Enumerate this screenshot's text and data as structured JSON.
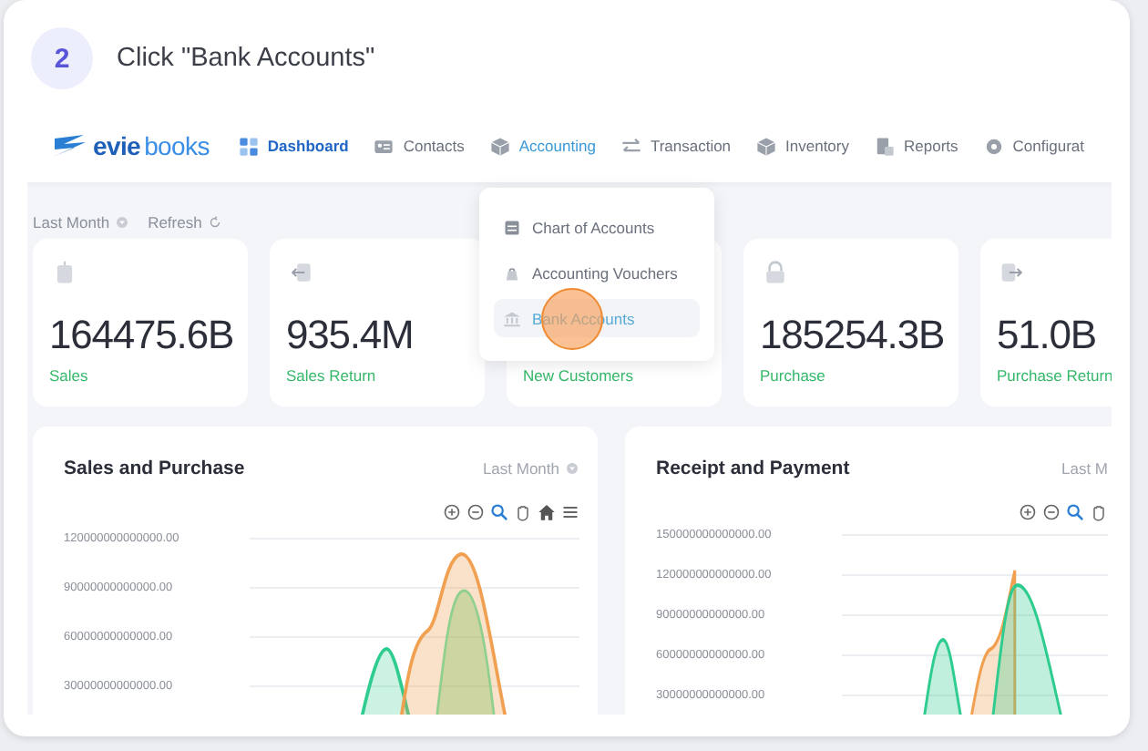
{
  "step": {
    "number": "2",
    "instruction": "Click \"Bank Accounts\""
  },
  "app": {
    "logo": {
      "part1": "evie",
      "part2": "books"
    },
    "nav": [
      {
        "label": "Dashboard",
        "selected": true
      },
      {
        "label": "Contacts",
        "selected": false
      },
      {
        "label": "Accounting",
        "selected": false,
        "open": true
      },
      {
        "label": "Transaction",
        "selected": false
      },
      {
        "label": "Inventory",
        "selected": false
      },
      {
        "label": "Reports",
        "selected": false
      },
      {
        "label": "Configurat",
        "selected": false
      }
    ],
    "filters": [
      {
        "label": "Last Month"
      },
      {
        "label": "Refresh"
      }
    ],
    "stats": [
      {
        "value": "164475.6B",
        "label": "Sales"
      },
      {
        "value": "935.4M",
        "label": "Sales Return"
      },
      {
        "label": "New Customers"
      },
      {
        "value": "185254.3B",
        "label": "Purchase"
      },
      {
        "value": "51.0B",
        "label": "Purchase Return"
      }
    ],
    "menu": [
      {
        "label": "Chart of Accounts",
        "highlighted": false
      },
      {
        "label": "Accounting Vouchers",
        "highlighted": false
      },
      {
        "label": "Bank Accounts",
        "highlighted": true
      }
    ],
    "charts": [
      {
        "title": "Sales and Purchase",
        "period": "Last Month",
        "y_labels": [
          "120000000000000.00",
          "90000000000000.00",
          "60000000000000.00",
          "30000000000000.00"
        ]
      },
      {
        "title": "Receipt and Payment",
        "period": "Last M",
        "y_labels": [
          "150000000000000.00",
          "120000000000000.00",
          "90000000000000.00",
          "60000000000000.00",
          "30000000000000.00"
        ]
      }
    ]
  }
}
